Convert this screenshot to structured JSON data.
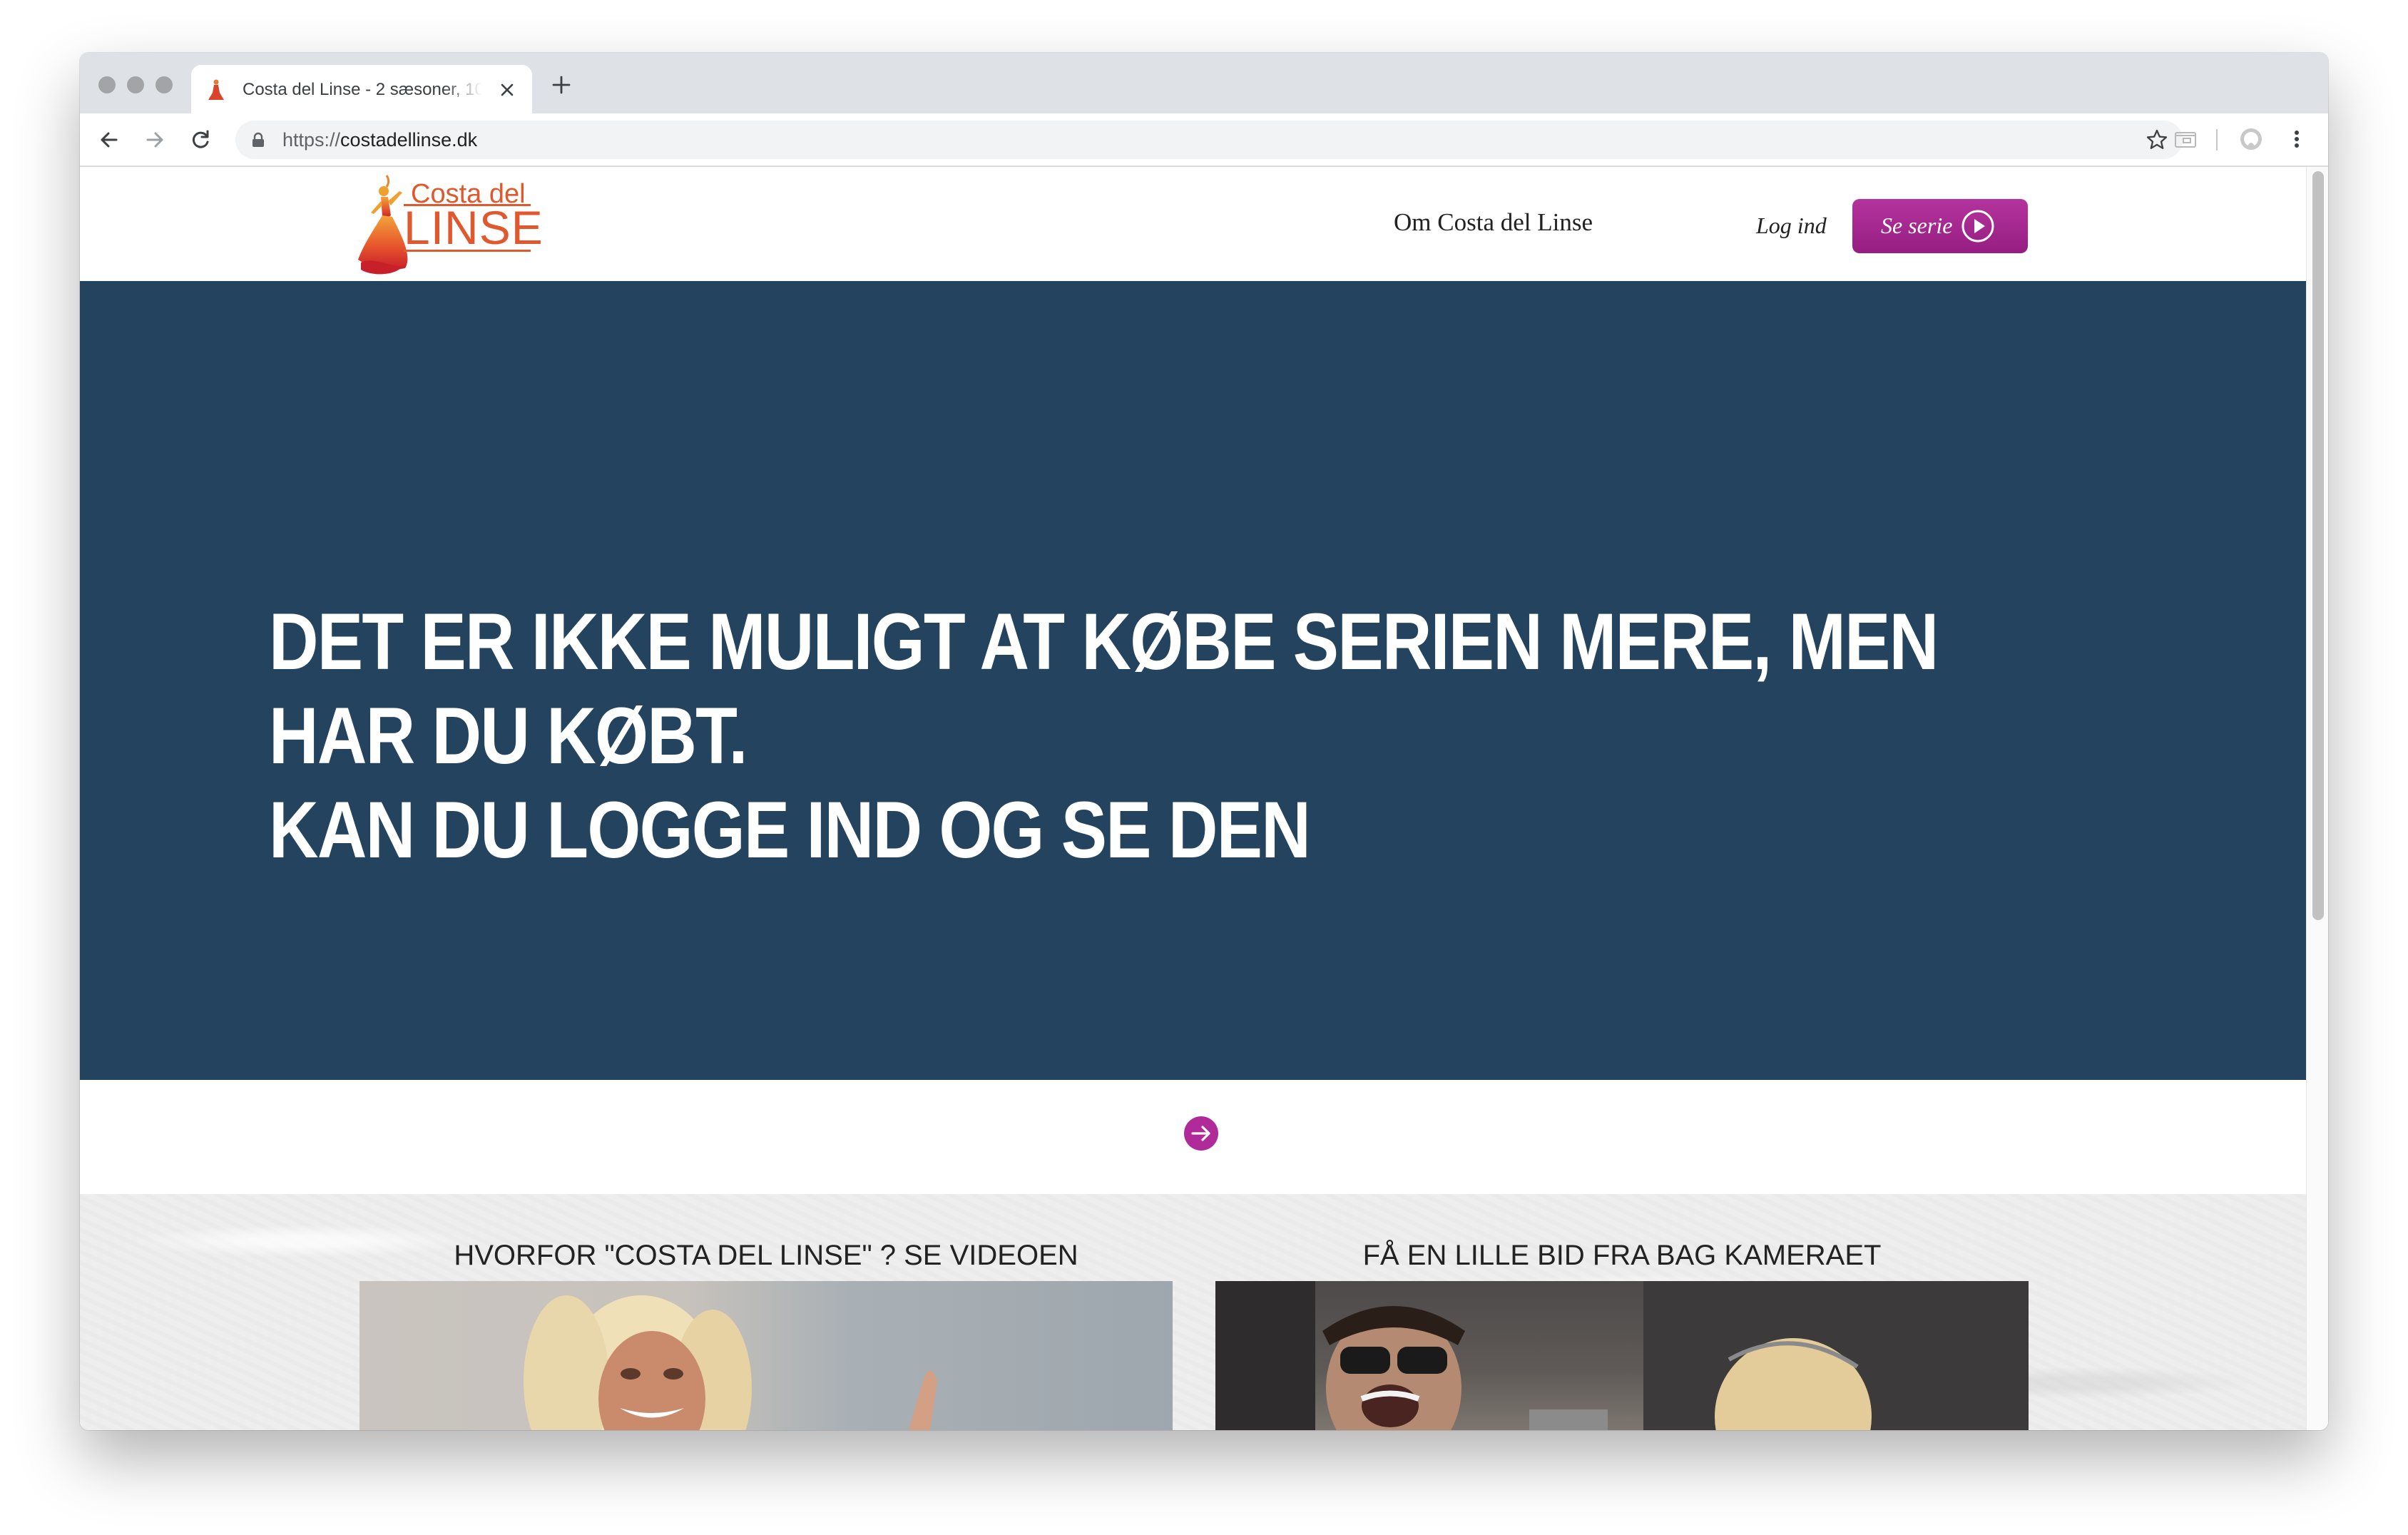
{
  "browser": {
    "tab_title": "Costa del Linse - 2 sæsoner, 10",
    "url_scheme": "https://",
    "url_host": "costadellinse.dk"
  },
  "site": {
    "logo_line1": "Costa del",
    "logo_line2": "LINSE",
    "nav_about": "Om Costa del Linse",
    "nav_login": "Log ind",
    "cta_label": "Se serie"
  },
  "hero": {
    "headline": "DET ER IKKE MULIGT AT KØBE SERIEN MERE, MEN HAR DU KØBT.\nKAN DU LOGGE IND OG SE DEN"
  },
  "videos": [
    {
      "title": "HVORFOR \"COSTA DEL LINSE\" ? SE VIDEOEN"
    },
    {
      "title": "FÅ EN LILLE BID FRA BAG KAMERAET"
    }
  ],
  "colors": {
    "hero_bg": "#23435e",
    "cta_purple": "#a52790",
    "logo_orange": "#e0582e"
  }
}
